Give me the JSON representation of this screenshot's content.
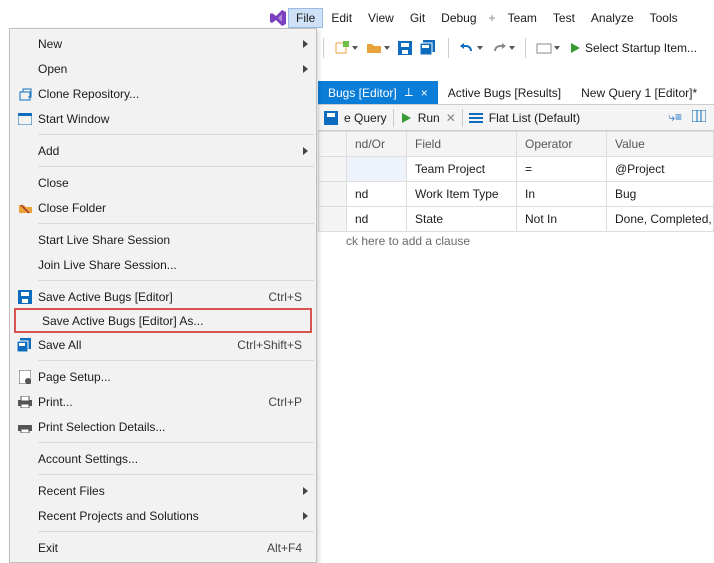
{
  "menubar": {
    "items": [
      "File",
      "Edit",
      "View",
      "Git",
      "Debug",
      "Team",
      "Test",
      "Analyze",
      "Tools"
    ],
    "active": "File"
  },
  "toolbar": {
    "startup_label": "Select Startup Item..."
  },
  "tabs": {
    "active": "Bugs [Editor]",
    "t1": "Active Bugs [Results]",
    "t2": "New Query 1 [Editor]*"
  },
  "querybar": {
    "savequery": "e Query",
    "run": "Run",
    "flat": "Flat List (Default)"
  },
  "grid": {
    "headers": {
      "andor": "nd/Or",
      "field": "Field",
      "operator": "Operator",
      "value": "Value"
    },
    "rows": [
      {
        "andor": "",
        "field": "Team Project",
        "op": "=",
        "val": "@Project"
      },
      {
        "andor": "nd",
        "field": "Work Item Type",
        "op": "In",
        "val": "Bug"
      },
      {
        "andor": "nd",
        "field": "State",
        "op": "Not In",
        "val": "Done, Completed,"
      }
    ],
    "addclause": "ck here to add a clause"
  },
  "filemenu": {
    "new": "New",
    "open": "Open",
    "clone": "Clone Repository...",
    "startwin": "Start Window",
    "add": "Add",
    "close": "Close",
    "closefolder": "Close Folder",
    "startlive": "Start Live Share Session",
    "joinlive": "Join Live Share Session...",
    "save": "Save Active Bugs [Editor]",
    "save_sc": "Ctrl+S",
    "saveas": "Save Active Bugs [Editor] As...",
    "saveall": "Save All",
    "saveall_sc": "Ctrl+Shift+S",
    "pagesetup": "Page Setup...",
    "print": "Print...",
    "print_sc": "Ctrl+P",
    "printsel": "Print Selection Details...",
    "account": "Account Settings...",
    "recentfiles": "Recent Files",
    "recentproj": "Recent Projects and Solutions",
    "exit": "Exit",
    "exit_sc": "Alt+F4"
  }
}
